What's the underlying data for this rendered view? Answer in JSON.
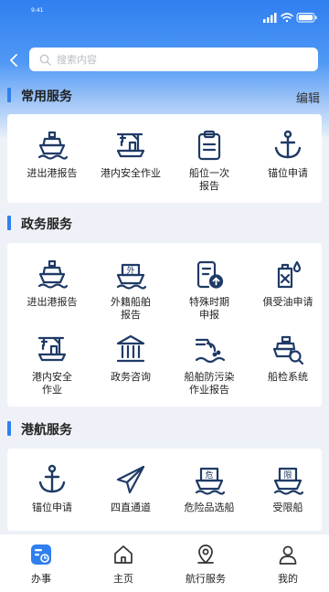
{
  "status_bar": {
    "time": "9:41",
    "icons": [
      "signal-icon",
      "wifi-icon",
      "battery-icon"
    ]
  },
  "search": {
    "placeholder": "搜索内容"
  },
  "sections": {
    "common": {
      "title": "常用服务",
      "edit": "编辑",
      "items": [
        "进出港报告",
        "港内安全作业",
        "船位一次\n报告",
        "锚位申请"
      ]
    },
    "gov": {
      "title": "政务服务",
      "items": [
        "进出港报告",
        "外籍船舶\n报告",
        "特殊时期\n申报",
        "俱受油申请",
        "港内安全\n作业",
        "政务咨询",
        "船舶防污染\n作业报告",
        "船检系统"
      ]
    },
    "nav": {
      "title": "港航服务",
      "items": [
        "锚位申请",
        "四直通道",
        "危险品选船",
        "受限船"
      ],
      "badges": {
        "danger": "危",
        "limited": "限",
        "foreign": "外"
      }
    }
  },
  "tabbar": {
    "items": [
      "办事",
      "主页",
      "航行服务",
      "我的"
    ],
    "active": "办事"
  },
  "colors": {
    "accent": "#2f7ff0",
    "icon": "#1f3a66",
    "header_top": "#2f7ff0"
  }
}
